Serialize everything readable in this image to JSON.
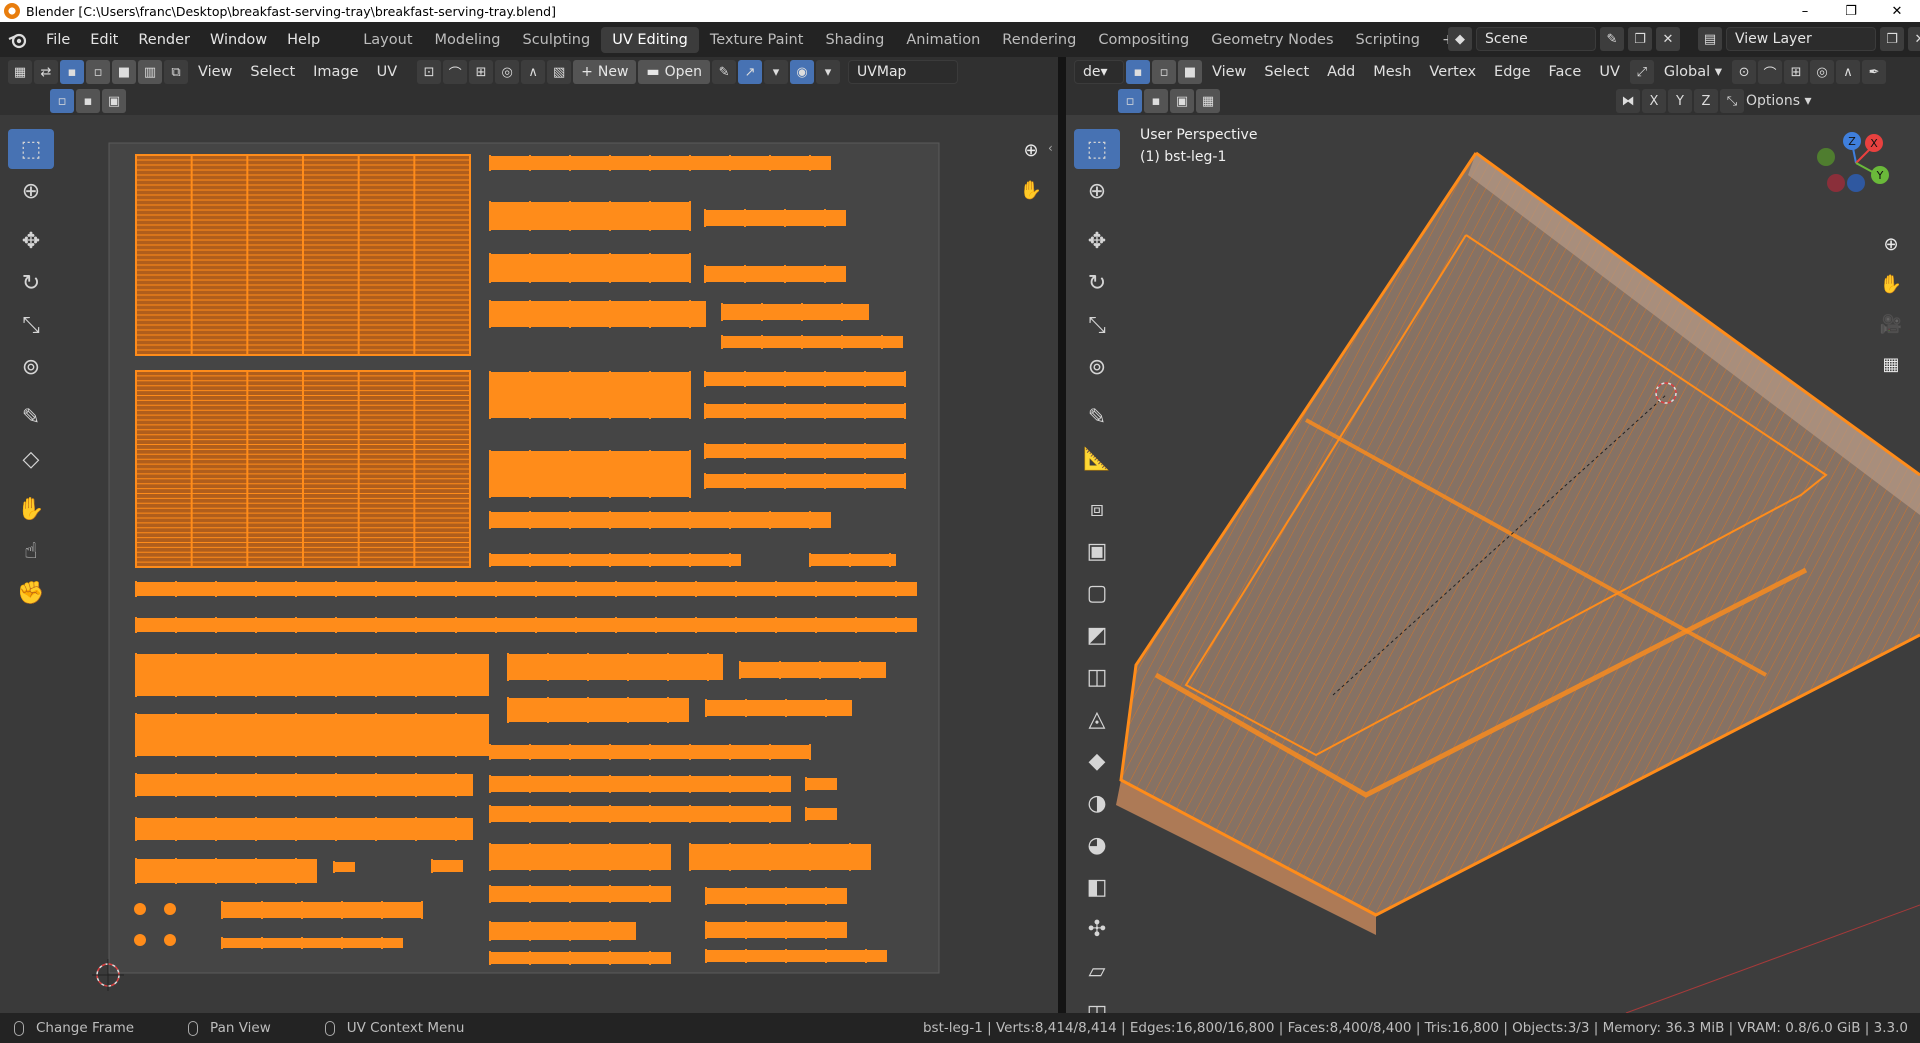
{
  "window": {
    "title": "Blender [C:\\Users\\franc\\Desktop\\breakfast-serving-tray\\breakfast-serving-tray.blend]",
    "controls": [
      "–",
      "❐",
      "✕"
    ]
  },
  "topbar": {
    "menus": [
      "File",
      "Edit",
      "Render",
      "Window",
      "Help"
    ],
    "workspaces": [
      "Layout",
      "Modeling",
      "Sculpting",
      "UV Editing",
      "Texture Paint",
      "Shading",
      "Animation",
      "Rendering",
      "Compositing",
      "Geometry Nodes",
      "Scripting"
    ],
    "active_workspace": "UV Editing",
    "add_tab": "+",
    "scene": "Scene",
    "view_layer": "View Layer"
  },
  "uv_editor": {
    "menus": [
      "View",
      "Select",
      "Image",
      "UV"
    ],
    "new_label": "New",
    "open_label": "Open",
    "uvmap": "UVMap"
  },
  "viewport": {
    "mode": "de",
    "menus": [
      "View",
      "Select",
      "Add",
      "Mesh",
      "Vertex",
      "Edge",
      "Face",
      "UV"
    ],
    "orientation": "Global",
    "axes": [
      "X",
      "Y",
      "Z"
    ],
    "options_label": "Options",
    "overlay_title": "User Perspective",
    "overlay_object": "(1) bst-leg-1",
    "gizmo": {
      "x": "X",
      "y": "Y",
      "z": "Z"
    }
  },
  "statusbar": {
    "left": [
      "Change Frame",
      "Pan View",
      "UV Context Menu"
    ],
    "stats": "bst-leg-1 | Verts:8,414/8,414 | Edges:16,800/16,800 | Faces:8,400/8,400 | Tris:16,800 | Objects:3/3 | Memory: 36.3 MiB | VRAM: 0.8/6.0 GiB | 3.3.0"
  },
  "colors": {
    "accent": "#4772b3",
    "uv_orange": "#ff8c1a",
    "uv_fill": "#b05e1c",
    "gizmo_x": "#e8413f",
    "gizmo_y": "#6ab93a",
    "gizmo_z": "#3f7fdc"
  }
}
